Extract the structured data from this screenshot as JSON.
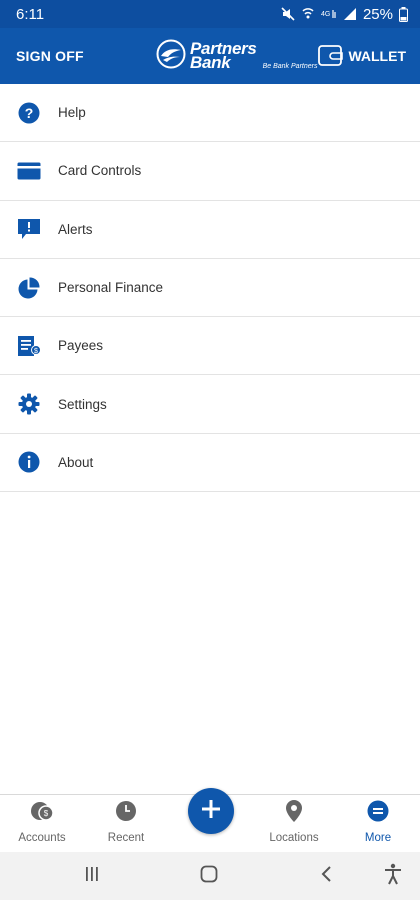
{
  "status_bar": {
    "time": "6:11",
    "battery": "25%",
    "icons": [
      "mute-icon",
      "wifi-calling-icon",
      "lte-icon",
      "signal-icon",
      "battery-icon"
    ]
  },
  "header": {
    "sign_off_label": "SIGN OFF",
    "logo_line1": "Partners",
    "logo_line2": "Bank",
    "logo_tagline": "Be Bank Partners",
    "wallet_label": "WALLET"
  },
  "menu": {
    "items": [
      {
        "label": "Help",
        "icon": "help-icon"
      },
      {
        "label": "Card Controls",
        "icon": "card-icon"
      },
      {
        "label": "Alerts",
        "icon": "alert-icon"
      },
      {
        "label": "Personal Finance",
        "icon": "pie-chart-icon"
      },
      {
        "label": "Payees",
        "icon": "payees-icon"
      },
      {
        "label": "Settings",
        "icon": "gear-icon"
      },
      {
        "label": "About",
        "icon": "info-icon"
      }
    ]
  },
  "bottom_nav": {
    "items": [
      {
        "label": "Accounts",
        "icon": "accounts-icon"
      },
      {
        "label": "Recent",
        "icon": "clock-icon"
      },
      {
        "label": "Locations",
        "icon": "location-pin-icon"
      },
      {
        "label": "More",
        "icon": "more-icon",
        "active": true
      }
    ],
    "fab_icon": "plus-icon"
  },
  "colors": {
    "brand": "#0f57ac",
    "status_bar": "#0d4ea0",
    "inactive_icon": "#666666"
  }
}
